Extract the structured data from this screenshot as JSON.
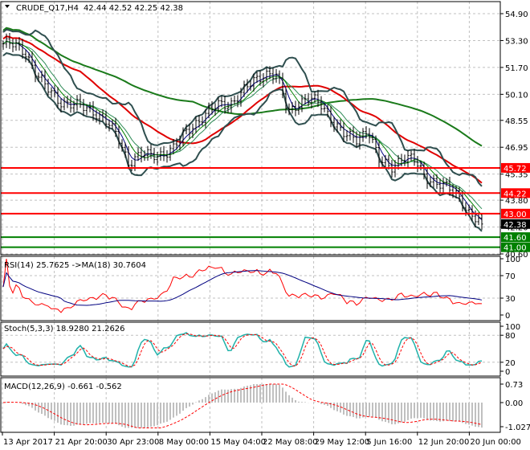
{
  "chart_data": {
    "type": "candlestick",
    "symbol_header": "CRUDE_Q17,H4",
    "ohlc_header": "42.44 42.52 42.25 42.38",
    "price_ticks": [
      "54.90",
      "53.30",
      "51.70",
      "50.10",
      "48.55",
      "46.95",
      "45.35",
      "43.80",
      "42.20",
      "40.60"
    ],
    "ylim": [
      40.6,
      54.9
    ],
    "time_labels": [
      "13 Apr 2017",
      "21 Apr 20:00",
      "30 Apr 23:00",
      "8 May 00:00",
      "15 May 04:00",
      "22 May 08:00",
      "29 May 12:00",
      "5 Jun 16:00",
      "12 Jun 20:00",
      "20 Jun 00:00"
    ],
    "close": [
      53.1,
      53.0,
      52.6,
      51.2,
      50.3,
      49.7,
      49.5,
      49.3,
      49.1,
      48.5,
      47.6,
      46.1,
      46.5,
      46.4,
      46.6,
      46.9,
      47.8,
      48.5,
      49.0,
      49.5,
      49.6,
      50.2,
      50.9,
      51.4,
      51.2,
      49.0,
      49.7,
      49.8,
      49.4,
      48.5,
      47.6,
      47.4,
      48.1,
      46.1,
      45.7,
      46.4,
      46.2,
      45.2,
      44.9,
      44.5,
      44.0,
      43.0,
      42.38
    ],
    "levels": [
      {
        "value": "45.72",
        "color": "#ff0000"
      },
      {
        "value": "44.22",
        "color": "#ff0000"
      },
      {
        "value": "43.00",
        "color": "#ff0000"
      },
      {
        "value": "41.60",
        "color": "#008000"
      },
      {
        "value": "41.00",
        "color": "#008000"
      }
    ],
    "current_price": "42.38",
    "grid": true,
    "colors": {
      "ma_slow": "#1a7a1a",
      "ma_mid": "#e00000",
      "bands": "#2f4f4f",
      "bars": "#000000"
    },
    "rsi": {
      "label": "RSI(14) 25.7625  ->MA(18) 30.7604",
      "ticks": [
        "100",
        "70",
        "30",
        "0"
      ],
      "colors": {
        "rsi": "#ff0000",
        "ma": "#000080"
      }
    },
    "stoch": {
      "label": "Stoch(5,3,3) 18.9280 21.2626",
      "ticks": [
        "100",
        "80",
        "20",
        "0"
      ],
      "colors": {
        "main": "#20b2aa",
        "signal": "#ff0000"
      }
    },
    "macd": {
      "label": "MACD(12,26,9) -0.661 -0.562",
      "ticks": [
        "0.73",
        "0.00",
        "-1.027"
      ],
      "colors": {
        "hist": "#c0c0c0",
        "signal": "#ff0000"
      }
    }
  }
}
